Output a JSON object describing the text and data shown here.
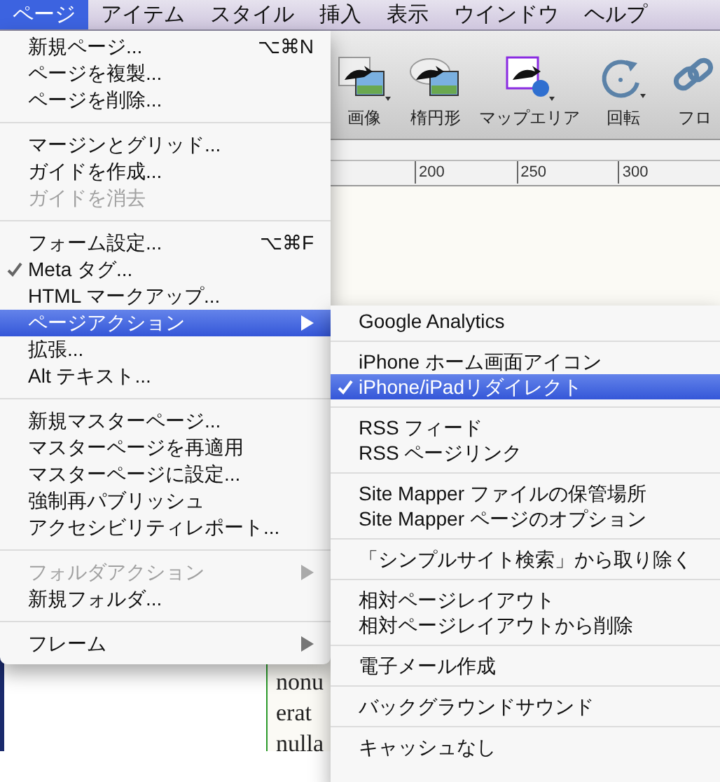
{
  "menubar": [
    {
      "label": "ページ",
      "selected": true
    },
    {
      "label": "アイテム",
      "selected": false
    },
    {
      "label": "スタイル",
      "selected": false
    },
    {
      "label": "挿入",
      "selected": false
    },
    {
      "label": "表示",
      "selected": false
    },
    {
      "label": "ウインドウ",
      "selected": false
    },
    {
      "label": "ヘルプ",
      "selected": false
    }
  ],
  "toolbar": [
    {
      "label": "画像",
      "kind": "image"
    },
    {
      "label": "楕円形",
      "kind": "ellipse"
    },
    {
      "label": "マップエリア",
      "kind": "maparea"
    },
    {
      "label": "回転",
      "kind": "rotate"
    },
    {
      "label": "フロ",
      "kind": "link"
    }
  ],
  "ruler": [
    "200",
    "250",
    "300"
  ],
  "canvas_text": [
    "nonu",
    "erat",
    "nulla"
  ],
  "menu": {
    "groups": [
      [
        {
          "label": "新規ページ...",
          "shortcut": "⌥⌘N",
          "checked": false,
          "disabled": false,
          "submenu": false,
          "selected": false
        },
        {
          "label": "ページを複製...",
          "checked": false,
          "disabled": false,
          "submenu": false,
          "selected": false
        },
        {
          "label": "ページを削除...",
          "checked": false,
          "disabled": false,
          "submenu": false,
          "selected": false
        }
      ],
      [
        {
          "label": "マージンとグリッド...",
          "checked": false,
          "disabled": false,
          "submenu": false,
          "selected": false
        },
        {
          "label": "ガイドを作成...",
          "checked": false,
          "disabled": false,
          "submenu": false,
          "selected": false
        },
        {
          "label": "ガイドを消去",
          "checked": false,
          "disabled": true,
          "submenu": false,
          "selected": false
        }
      ],
      [
        {
          "label": "フォーム設定...",
          "shortcut": "⌥⌘F",
          "checked": false,
          "disabled": false,
          "submenu": false,
          "selected": false
        },
        {
          "label": "Meta タグ...",
          "checked": true,
          "disabled": false,
          "submenu": false,
          "selected": false
        },
        {
          "label": "HTML マークアップ...",
          "checked": false,
          "disabled": false,
          "submenu": false,
          "selected": false
        },
        {
          "label": "ページアクション",
          "checked": false,
          "disabled": false,
          "submenu": true,
          "selected": true
        },
        {
          "label": "拡張...",
          "checked": false,
          "disabled": false,
          "submenu": false,
          "selected": false
        },
        {
          "label": "Alt テキスト...",
          "checked": false,
          "disabled": false,
          "submenu": false,
          "selected": false
        }
      ],
      [
        {
          "label": "新規マスターページ...",
          "checked": false,
          "disabled": false,
          "submenu": false,
          "selected": false
        },
        {
          "label": "マスターページを再適用",
          "checked": false,
          "disabled": false,
          "submenu": false,
          "selected": false
        },
        {
          "label": "マスターページに設定...",
          "checked": false,
          "disabled": false,
          "submenu": false,
          "selected": false
        },
        {
          "label": "強制再パブリッシュ",
          "checked": false,
          "disabled": false,
          "submenu": false,
          "selected": false
        },
        {
          "label": "アクセシビリティレポート...",
          "checked": false,
          "disabled": false,
          "submenu": false,
          "selected": false
        }
      ],
      [
        {
          "label": "フォルダアクション",
          "checked": false,
          "disabled": true,
          "submenu": true,
          "selected": false
        },
        {
          "label": "新規フォルダ...",
          "checked": false,
          "disabled": false,
          "submenu": false,
          "selected": false
        }
      ],
      [
        {
          "label": "フレーム",
          "checked": false,
          "disabled": false,
          "submenu": true,
          "selected": false
        }
      ]
    ]
  },
  "submenu": {
    "groups": [
      [
        {
          "label": "Google Analytics",
          "checked": false,
          "selected": false
        }
      ],
      [
        {
          "label": "iPhone ホーム画面アイコン",
          "checked": false,
          "selected": false
        },
        {
          "label": "iPhone/iPadリダイレクト",
          "checked": true,
          "selected": true
        }
      ],
      [
        {
          "label": "RSS フィード",
          "checked": false,
          "selected": false
        },
        {
          "label": "RSS ページリンク",
          "checked": false,
          "selected": false
        }
      ],
      [
        {
          "label": "Site Mapper ファイルの保管場所",
          "checked": false,
          "selected": false
        },
        {
          "label": "Site Mapper ページのオプション",
          "checked": false,
          "selected": false
        }
      ],
      [
        {
          "label": "「シンプルサイト検索」から取り除く",
          "checked": false,
          "selected": false
        }
      ],
      [
        {
          "label": "相対ページレイアウト",
          "checked": false,
          "selected": false
        },
        {
          "label": "相対ページレイアウトから削除",
          "checked": false,
          "selected": false
        }
      ],
      [
        {
          "label": "電子メール作成",
          "checked": false,
          "selected": false
        }
      ],
      [
        {
          "label": "バックグラウンドサウンド",
          "checked": false,
          "selected": false
        }
      ],
      [
        {
          "label": "キャッシュなし",
          "checked": false,
          "selected": false
        }
      ]
    ]
  }
}
